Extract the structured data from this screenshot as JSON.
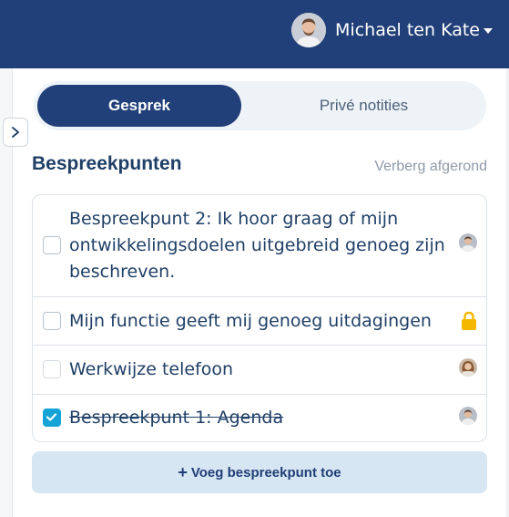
{
  "header": {
    "user_name": "Michael ten Kate",
    "avatar_icon": "user-avatar",
    "menu_icon": "caret-down-icon",
    "background_color": "#213f78"
  },
  "sidebar": {
    "expand_icon": "chevron-right-icon"
  },
  "tabs": [
    {
      "label": "Gesprek",
      "active": true
    },
    {
      "label": "Privé notities",
      "active": false
    }
  ],
  "section": {
    "title": "Bespreekpunten",
    "hide_completed_label": "Verberg afgerond"
  },
  "items": [
    {
      "text": "Bespreekpunt 2: Ik hoor graag of mijn ontwikkelingsdoelen uitgebreid genoeg zijn beschreven.",
      "checked": false,
      "indicator": "avatar-male"
    },
    {
      "text": "Mijn functie geeft mij genoeg uitdagingen",
      "checked": false,
      "indicator": "lock-icon"
    },
    {
      "text": "Werkwijze telefoon",
      "checked": false,
      "indicator": "avatar-female"
    },
    {
      "text": "Bespreekpunt 1: Agenda",
      "checked": true,
      "indicator": "avatar-male"
    }
  ],
  "add_button": {
    "label": "Voeg bespreekpunt toe",
    "icon": "plus-icon"
  },
  "colors": {
    "primary": "#213f78",
    "checkbox_checked": "#16a3d7",
    "add_button_bg": "#d6e6f3",
    "lock": "#f5b800"
  }
}
